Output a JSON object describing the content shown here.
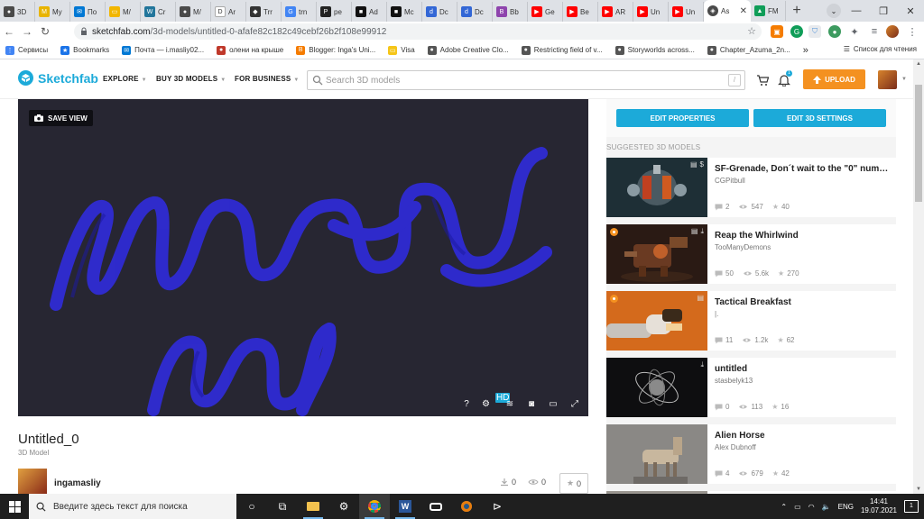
{
  "browser": {
    "tabs": [
      {
        "label": "3D",
        "color": "#4a4a4a",
        "glyph": "●"
      },
      {
        "label": "My",
        "color": "#e8b400",
        "glyph": "M"
      },
      {
        "label": "По",
        "color": "#0078d4",
        "glyph": "✉"
      },
      {
        "label": "M/",
        "color": "#f2b600",
        "glyph": "▭"
      },
      {
        "label": "Cr",
        "color": "#21759b",
        "glyph": "W"
      },
      {
        "label": "M/",
        "color": "#4a4a4a",
        "glyph": "●"
      },
      {
        "label": "Ar",
        "color": "#ffffff",
        "glyph": "D"
      },
      {
        "label": "Trr",
        "color": "#333333",
        "glyph": "◆"
      },
      {
        "label": "trn",
        "color": "#4285f4",
        "glyph": "G"
      },
      {
        "label": "pe",
        "color": "#222222",
        "glyph": "P"
      },
      {
        "label": "Ad",
        "color": "#111111",
        "glyph": "■"
      },
      {
        "label": "Mc",
        "color": "#111111",
        "glyph": "■"
      },
      {
        "label": "Dc",
        "color": "#3367d6",
        "glyph": "d"
      },
      {
        "label": "Dc",
        "color": "#3367d6",
        "glyph": "d"
      },
      {
        "label": "Bb",
        "color": "#8e44ad",
        "glyph": "B"
      },
      {
        "label": "Ge",
        "color": "#ff0000",
        "glyph": "▶"
      },
      {
        "label": "Be",
        "color": "#ff0000",
        "glyph": "▶"
      },
      {
        "label": "AR",
        "color": "#ff0000",
        "glyph": "▶"
      },
      {
        "label": "Un",
        "color": "#ff0000",
        "glyph": "▶"
      },
      {
        "label": "Un",
        "color": "#ff0000",
        "glyph": "▶"
      },
      {
        "label": "As",
        "color": "#4a4a4a",
        "glyph": "◈"
      }
    ],
    "active_tab_close": "✕",
    "extra_tab": {
      "label": "FM",
      "color": "#0f9d58",
      "glyph": "▲"
    },
    "url_host": "sketchfab.com",
    "url_path": "/3d-models/untitled-0-afafe82c182c49cebf26b2f108e99912",
    "bookmarks": [
      {
        "label": "Сервисы",
        "color": "#4285f4",
        "glyph": "⋮"
      },
      {
        "label": "Bookmarks",
        "color": "#1a73e8",
        "glyph": "★"
      },
      {
        "label": "Почта — i.masliy02...",
        "color": "#0078d4",
        "glyph": "✉"
      },
      {
        "label": "олени на крыше",
        "color": "#c0392b",
        "glyph": "●"
      },
      {
        "label": "Blogger: Inga's Uni...",
        "color": "#f57c00",
        "glyph": "B"
      },
      {
        "label": "Visa",
        "color": "#f5c518",
        "glyph": "▭"
      },
      {
        "label": "Adobe Creative Clo...",
        "color": "#555555",
        "glyph": "●"
      },
      {
        "label": "Restricting field of v...",
        "color": "#555555",
        "glyph": "●"
      },
      {
        "label": "Storyworlds across...",
        "color": "#555555",
        "glyph": "●"
      },
      {
        "label": "Chapter_Azuma_2n...",
        "color": "#555555",
        "glyph": "●"
      }
    ],
    "bookmark_more": "»",
    "reading_list": "Список для чтения"
  },
  "sketchfab": {
    "logo": "Sketchfab",
    "nav": [
      "EXPLORE",
      "BUY 3D MODELS",
      "FOR BUSINESS"
    ],
    "search_placeholder": "Search 3D models",
    "search_shortcut": "/",
    "notification_count": "1",
    "upload_label": "UPLOAD"
  },
  "viewer": {
    "save_view": "SAVE VIEW",
    "controls": [
      "?",
      "⚙",
      "≋",
      "◙",
      "▭",
      "⤢"
    ],
    "hd": "HD",
    "background_color": "#272632",
    "ribbon_color": "#2f2bd4"
  },
  "model": {
    "title": "Untitled_0",
    "subtitle": "3D Model",
    "author": "ingamasliy",
    "downloads": "0",
    "views": "0",
    "likes": "0"
  },
  "sidebar": {
    "edit_properties": "EDIT PROPERTIES",
    "edit_3d_settings": "EDIT 3D SETTINGS",
    "suggested_heading": "SUGGESTED 3D MODELS",
    "cards": [
      {
        "title": "SF-Grenade, Don´t wait to the \"0\" numbe...",
        "author": "CGPitbull",
        "comments": "2",
        "views": "547",
        "likes": "40",
        "thumb": "grenade"
      },
      {
        "title": "Reap the Whirlwind",
        "author": "TooManyDemons",
        "comments": "50",
        "views": "5.6k",
        "likes": "270",
        "thumb": "robot"
      },
      {
        "title": "Tactical Breakfast",
        "author": "|.",
        "comments": "11",
        "views": "1.2k",
        "likes": "62",
        "thumb": "hand"
      },
      {
        "title": "untitled",
        "author": "stasbelyk13",
        "comments": "0",
        "views": "113",
        "likes": "16",
        "thumb": "orbit"
      },
      {
        "title": "Alien Horse",
        "author": "Alex Dubnoff",
        "comments": "4",
        "views": "679",
        "likes": "42",
        "thumb": "horse"
      }
    ]
  },
  "taskbar": {
    "search_placeholder": "Введите здесь текст для поиска",
    "language": "ENG",
    "time": "14:41",
    "date": "19.07.2021",
    "notifications": "1"
  }
}
